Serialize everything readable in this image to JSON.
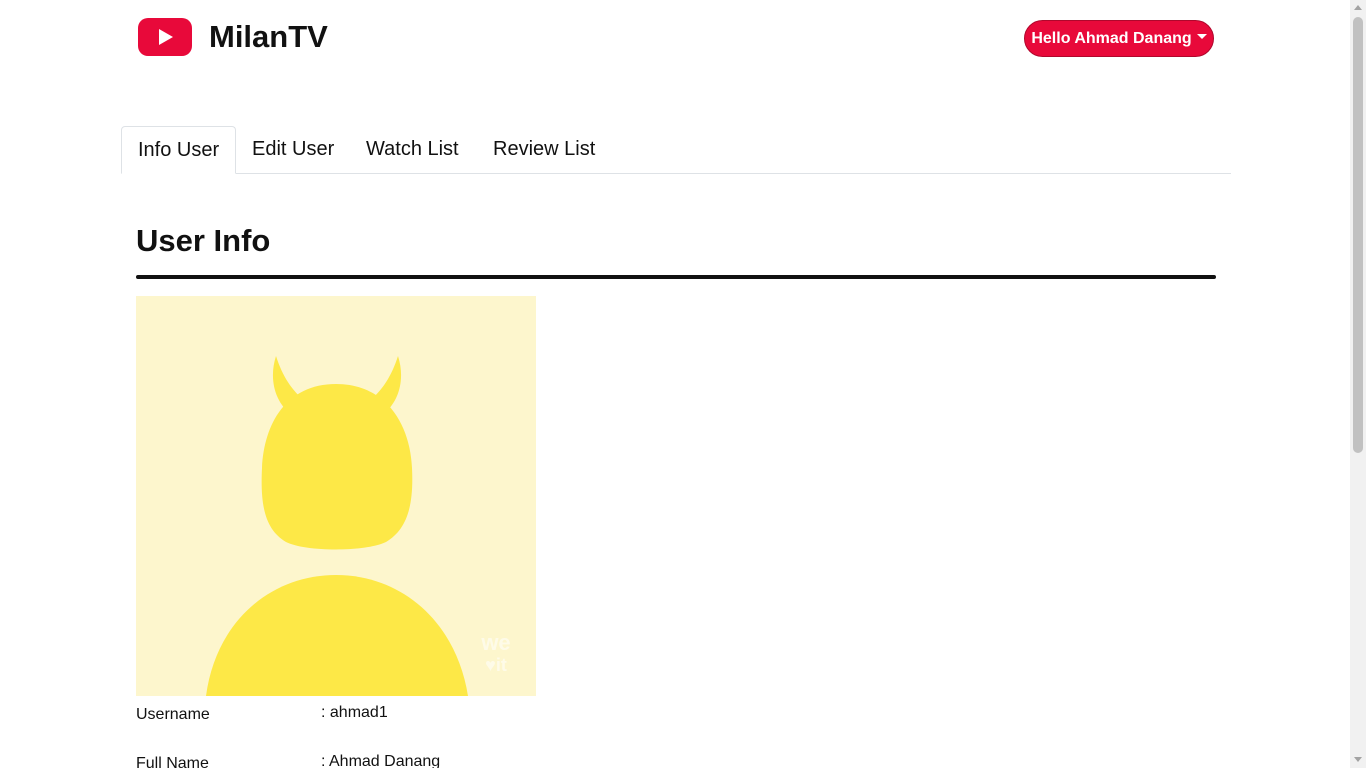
{
  "brand": {
    "name": "MilanTV",
    "logo_icon": "youtube-play-icon",
    "color": "#e8093a"
  },
  "user_menu": {
    "label": "Hello Ahmad Danang"
  },
  "tabs": [
    {
      "label": "Info User",
      "active": true
    },
    {
      "label": "Edit User",
      "active": false
    },
    {
      "label": "Watch List",
      "active": false
    },
    {
      "label": "Review List",
      "active": false
    }
  ],
  "section": {
    "title": "User Info"
  },
  "avatar": {
    "icon": "devil-avatar-image",
    "background": "#fdf6cd",
    "figure_color": "#fde847",
    "watermark": "we it"
  },
  "user_info": [
    {
      "label": "Username",
      "value": ": ahmad1"
    },
    {
      "label": "Full Name",
      "value": ": Ahmad Danang"
    }
  ]
}
